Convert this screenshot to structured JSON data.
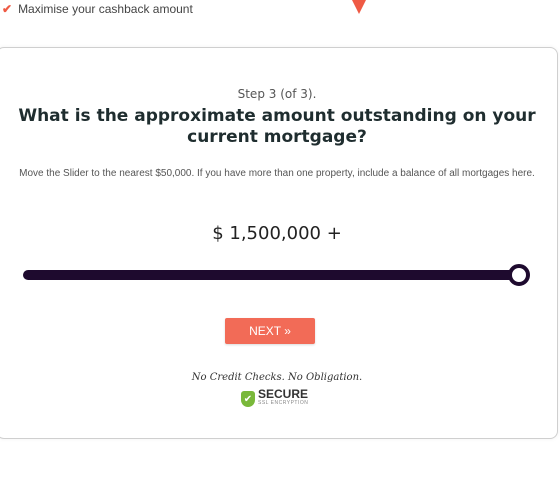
{
  "benefit": {
    "check_icon": "checkmark-icon",
    "text": "Maximise your cashback amount"
  },
  "form": {
    "step": "Step 3 (of 3).",
    "question": "What is the approximate amount outstanding on your current mortgage?",
    "hint": "Move the Slider to the nearest $50,000. If you have more than one property, include a balance of all mortgages here.",
    "amount": "$ 1,500,000 +",
    "slider": {
      "value_fraction": 1.0,
      "track_color": "#1e0a2e"
    },
    "next_label": "NEXT »",
    "next_color": "#f26b57",
    "no_credit": "No Credit Checks. No Obligation.",
    "secure": {
      "icon": "shield-check-icon",
      "label": "SECURE",
      "sublabel": "SSL ENCRYPTION"
    }
  }
}
